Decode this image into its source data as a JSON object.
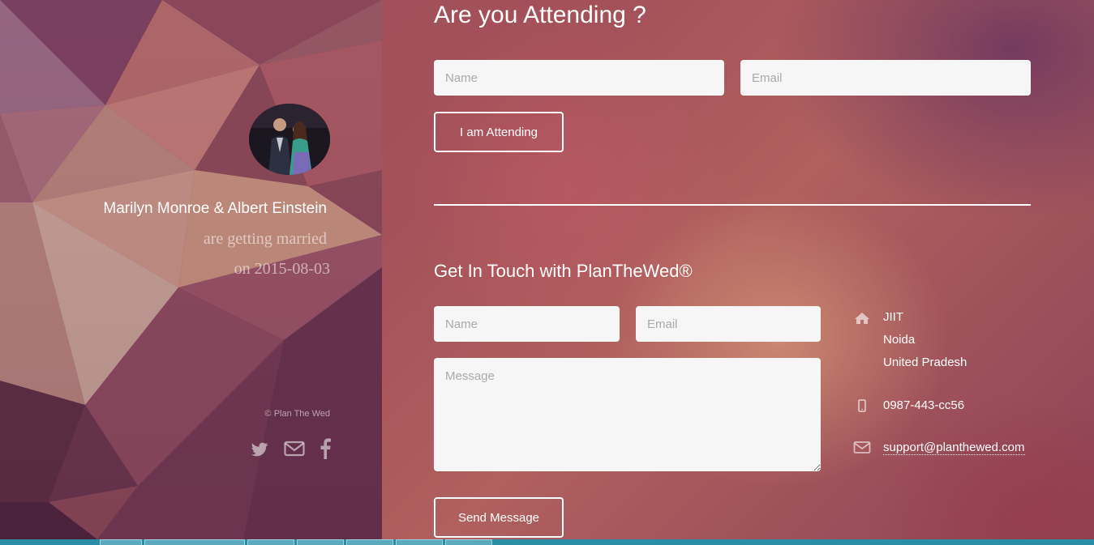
{
  "sidebar": {
    "couple_names": "Marilyn Monroe & Albert Einstein",
    "subtitle": "are getting married",
    "date_line": "on 2015-08-03",
    "copyright": "© Plan The Wed",
    "social_icons": [
      "twitter-icon",
      "envelope-icon",
      "facebook-icon"
    ]
  },
  "attending": {
    "heading": "Are you Attending ?",
    "name_placeholder": "Name",
    "email_placeholder": "Email",
    "button_label": "I am Attending"
  },
  "contact": {
    "heading": "Get In Touch with PlanTheWed®",
    "name_placeholder": "Name",
    "email_placeholder": "Email",
    "message_placeholder": "Message",
    "button_label": "Send Message",
    "address_line1": "JIIT",
    "address_line2": "Noida",
    "address_line3": "United Pradesh",
    "phone": "0987-443-cc56",
    "email": "support@planthewed.com"
  },
  "colors": {
    "accent_text": "#ffffff",
    "field_bg": "#f6f6f6",
    "taskbar": "#2a8fa6"
  }
}
